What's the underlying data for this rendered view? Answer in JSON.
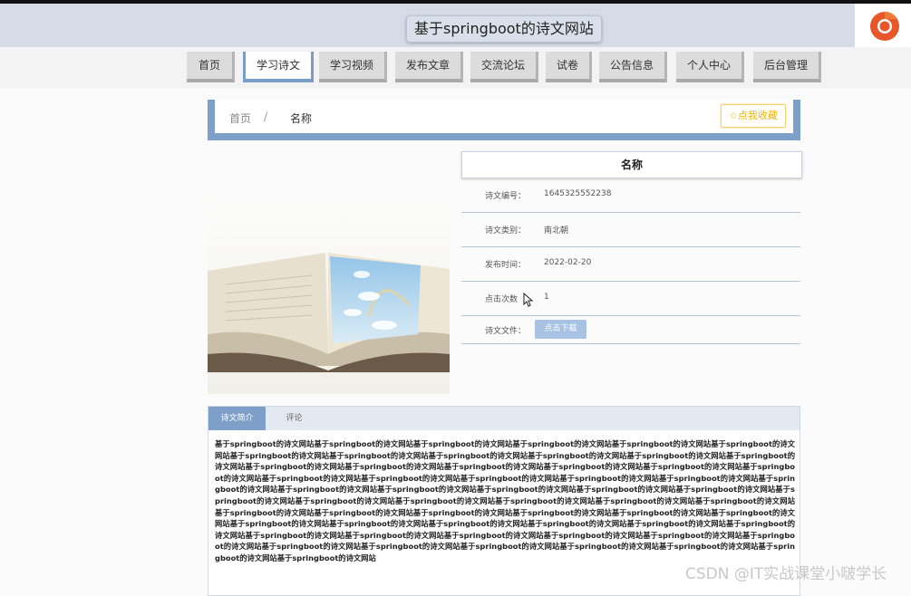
{
  "header": {
    "site_title": "基于springboot的诗文网站"
  },
  "nav": {
    "items": [
      {
        "label": "首页"
      },
      {
        "label": "学习诗文"
      },
      {
        "label": "学习视频"
      },
      {
        "label": "发布文章"
      },
      {
        "label": "交流论坛"
      },
      {
        "label": "试卷"
      },
      {
        "label": "公告信息"
      },
      {
        "label": "个人中心"
      },
      {
        "label": "后台管理"
      }
    ],
    "active": "学习诗文"
  },
  "breadcrumb": {
    "home": "首页",
    "separator": "/",
    "current": "名称"
  },
  "favorite_button": {
    "label": "☆点我收藏"
  },
  "detail": {
    "title": "名称",
    "fields": [
      {
        "label": "诗文编号：",
        "value": "1645325552238"
      },
      {
        "label": "诗文类别：",
        "value": "南北朝"
      },
      {
        "label": "发布时间：",
        "value": "2022-02-20"
      },
      {
        "label": "点击次数",
        "value": "1"
      },
      {
        "label": "诗文文件："
      }
    ],
    "download_label": "点击下载"
  },
  "tabs": {
    "items": [
      {
        "label": "诗文简介"
      },
      {
        "label": "评论"
      }
    ],
    "active": "诗文简介"
  },
  "intro": {
    "text": "基于springboot的诗文网站基于springboot的诗文网站基于springboot的诗文网站基于springboot的诗文网站基于springboot的诗文网站基于springboot的诗文网站基于springboot的诗文网站基于springboot的诗文网站基于springboot的诗文网站基于springboot的诗文网站基于springboot的诗文网站基于springboot的诗文网站基于springboot的诗文网站基于springboot的诗文网站基于springboot的诗文网站基于springboot的诗文网站基于springboot的诗文网站基于springboot的诗文网站基于springboot的诗文网站基于springboot的诗文网站基于springboot的诗文网站基于springboot的诗文网站基于springboot的诗文网站基于springboot的诗文网站基于springboot的诗文网站基于springboot的诗文网站基于springboot的诗文网站基于springboot的诗文网站基于springboot的诗文网站基于springboot的诗文网站基于springboot的诗文网站基于springboot的诗文网站基于springboot的诗文网站基于springboot的诗文网站基于springboot的诗文网站基于springboot的诗文网站基于springboot的诗文网站基于springboot的诗文网站基于springboot的诗文网站基于springboot的诗文网站基于springboot的诗文网站基于springboot的诗文网站基于springboot的诗文网站基于springboot的诗文网站基于springboot的诗文网站基于springboot的诗文网站基于springboot的诗文网站基于springboot的诗文网站基于springboot的诗文网站基于springboot的诗文网站基于springboot的诗文网站基于springboot的诗文网站基于springboot的诗文网站基于springboot的诗文网站基于springboot的诗文网站基于springboot的诗文网站基于springboot的诗文网站基于springboot的诗文网站基于springboot的诗文网站基于springboot的诗文网站"
  },
  "watermark": {
    "text": "CSDN @IT实战课堂小啵学长"
  },
  "colors": {
    "accent": "#7da0c8",
    "header_bg": "#d5dce6",
    "favorite": "#f0b400",
    "download_btn": "#a7c2e2"
  }
}
